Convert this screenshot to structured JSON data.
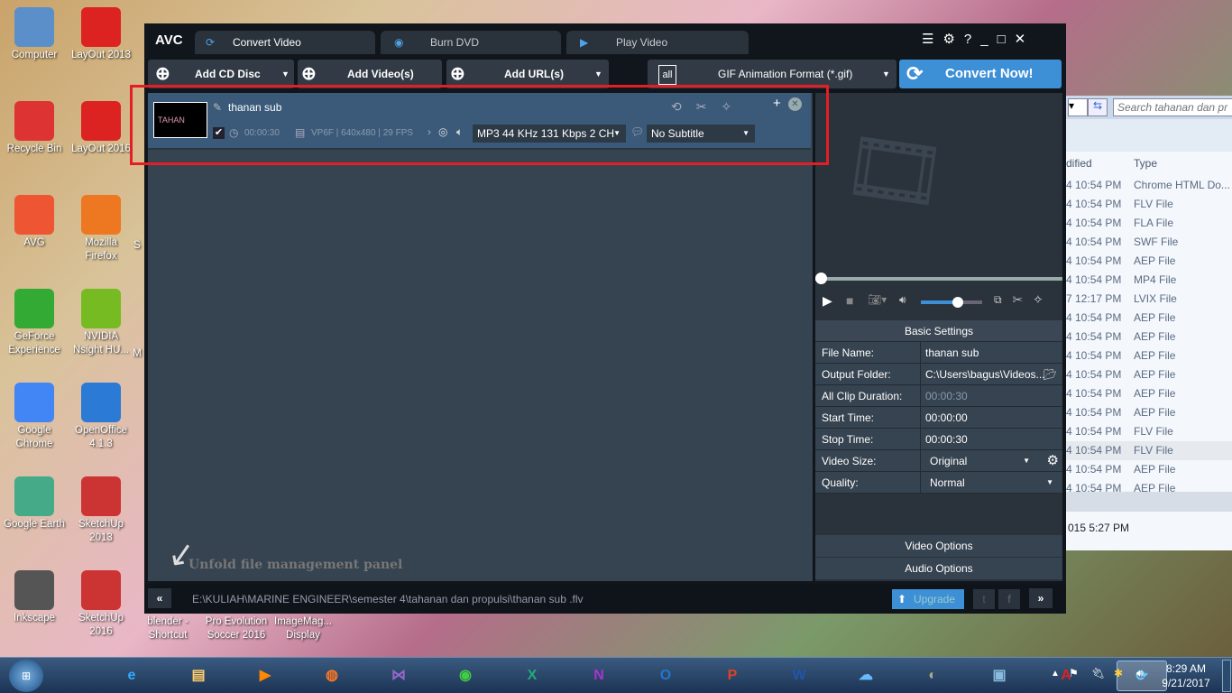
{
  "desktop": {
    "icons_col1": [
      "Computer",
      "Recycle Bin",
      "AVG",
      "GeForce Experience",
      "Google Chrome",
      "Google Earth",
      "Inkscape"
    ],
    "icons_col2": [
      "LayOut 2013",
      "LayOut 2016",
      "Mozilla Firefox",
      "NVIDIA Nsight HU...",
      "OpenOffice 4.1.3",
      "SketchUp 2013",
      "SketchUp 2016"
    ],
    "icons_bottom": [
      "blender - Shortcut",
      "Pro Evolution Soccer 2016",
      "ImageMag... Display"
    ],
    "partial": [
      "S",
      "M"
    ]
  },
  "explorer": {
    "search_placeholder": "Search tahanan dan pr",
    "col_modified": "dified",
    "col_type": "Type",
    "rows": [
      [
        "4 10:54 PM",
        "Chrome HTML Do..."
      ],
      [
        "4 10:54 PM",
        "FLV File"
      ],
      [
        "4 10:54 PM",
        "FLA File"
      ],
      [
        "4 10:54 PM",
        "SWF File"
      ],
      [
        "4 10:54 PM",
        "AEP File"
      ],
      [
        "4 10:54 PM",
        "MP4 File"
      ],
      [
        "7 12:17 PM",
        "LVIX File"
      ],
      [
        "4 10:54 PM",
        "AEP File"
      ],
      [
        "4 10:54 PM",
        "AEP File"
      ],
      [
        "4 10:54 PM",
        "AEP File"
      ],
      [
        "4 10:54 PM",
        "AEP File"
      ],
      [
        "4 10:54 PM",
        "AEP File"
      ],
      [
        "4 10:54 PM",
        "AEP File"
      ],
      [
        "4 10:54 PM",
        "FLV File"
      ],
      [
        "4 10:54 PM",
        "FLV File"
      ],
      [
        "4 10:54 PM",
        "AEP File"
      ],
      [
        "4 10:54 PM",
        "AEP File"
      ]
    ],
    "status": "015 5:27 PM"
  },
  "app": {
    "logo": "AVC",
    "tabs": [
      "Convert Video",
      "Burn DVD",
      "Play Video"
    ],
    "toolbar": {
      "add_cd": "Add CD Disc",
      "add_video": "Add Video(s)",
      "add_url": "Add URL(s)",
      "format": "GIF Animation Format (*.gif)",
      "format_icon": "all",
      "convert": "Convert Now!"
    },
    "item": {
      "thumb_text": "TAHAN",
      "name": "thanan sub",
      "duration": "00:00:30",
      "video_info": "VP6F | 640x480 | 29 FPS",
      "audio": "MP3 44 KHz 131 Kbps 2 CH",
      "subtitle": "No Subtitle",
      "checked": true
    },
    "hint": "Unfold file management panel",
    "settings": {
      "title": "Basic Settings",
      "rows": [
        {
          "k": "File Name:",
          "v": "thanan sub"
        },
        {
          "k": "Output Folder:",
          "v": "C:\\Users\\bagus\\Videos..."
        },
        {
          "k": "All Clip Duration:",
          "v": "00:00:30"
        },
        {
          "k": "Start Time:",
          "v": "00:00:00"
        },
        {
          "k": "Stop Time:",
          "v": "00:00:30"
        },
        {
          "k": "Video Size:",
          "v": "Original"
        },
        {
          "k": "Quality:",
          "v": "Normal"
        }
      ],
      "video_options": "Video Options",
      "audio_options": "Audio Options"
    },
    "player": {
      "progress": 0,
      "volume": 0.6
    },
    "path": "E:\\KULIAH\\MARINE ENGINEER\\semester 4\\tahanan dan propulsi\\thanan sub  .flv",
    "upgrade": "Upgrade",
    "accent": "#3d8fd6"
  },
  "taskbar": {
    "time": "8:29 AM",
    "date": "9/21/2017"
  }
}
